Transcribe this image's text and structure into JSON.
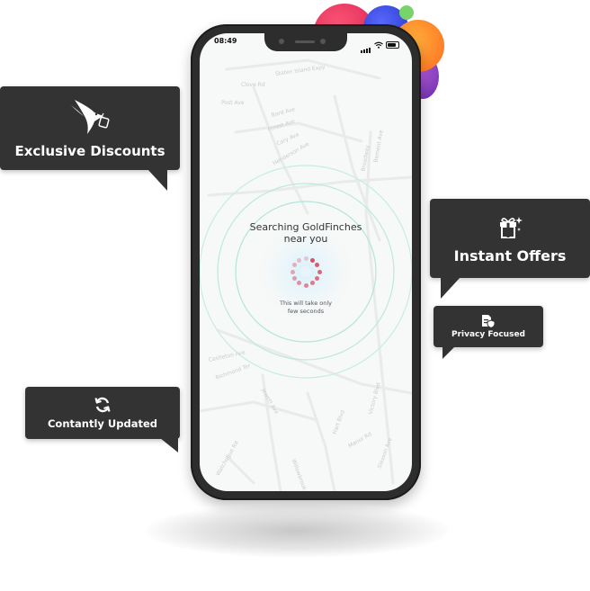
{
  "phone": {
    "status_time": "08:49",
    "search_title_line1": "Searching GoldFinches",
    "search_title_line2": "near you",
    "search_sub_line1": "This will take only",
    "search_sub_line2": "few seconds",
    "map_labels": [
      "Clove Rd",
      "Staten Island Expy",
      "Bard Ave",
      "Forest Ave",
      "Cary Ave",
      "Henderson Ave",
      "Broadway",
      "Bement Ave",
      "Post Ave",
      "Castleton Ave",
      "Richmond Ter",
      "Jewett Ave",
      "Victory Blvd",
      "Manor Rd",
      "Slosson Ave",
      "Watchogue Rd",
      "Willowbrook Rd",
      "Hart Blvd"
    ]
  },
  "bubbles": {
    "discounts": {
      "label": "Exclusive Discounts",
      "icon": "hummingbird-tag-icon"
    },
    "instant": {
      "label": "Instant Offers",
      "icon": "gift-sparkle-icon"
    },
    "privacy": {
      "label": "Privacy Focused",
      "icon": "document-shield-icon"
    },
    "updated": {
      "label": "Contantly Updated",
      "icon": "refresh-icon"
    }
  },
  "colors": {
    "bubble_bg": "#333333",
    "phone_frame": "#2d2d2d",
    "spinner_red": "#d6455b",
    "ring_teal": "#a9e3d9"
  }
}
